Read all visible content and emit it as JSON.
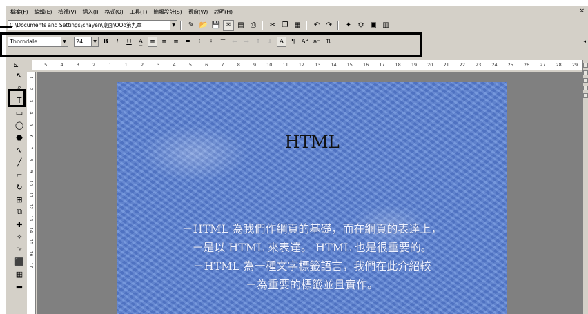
{
  "menubar": {
    "items": [
      "檔案(F)",
      "編輯(E)",
      "檢視(V)",
      "插入(I)",
      "格式(O)",
      "工具(T)",
      "簡報設計(S)",
      "視窗(W)",
      "說明(H)"
    ],
    "close": "×"
  },
  "toolbar": {
    "path": "C:\\Documents and Settings\\chayen\\桌面\\OOo第九章",
    "path_dropdown": "▼"
  },
  "format_toolbar": {
    "font_name": "Thorndale",
    "font_size": "24",
    "dropdown": "▼",
    "bold": "B",
    "italic": "I",
    "underline": "U"
  },
  "ruler": {
    "left_marks": [
      "5",
      "4",
      "3",
      "2",
      "1"
    ],
    "marks": [
      "1",
      "2",
      "3",
      "4",
      "5",
      "6",
      "7",
      "8",
      "9",
      "10",
      "11",
      "12",
      "13",
      "14",
      "15",
      "16",
      "17",
      "18",
      "19",
      "20",
      "21",
      "22",
      "23",
      "24",
      "25",
      "26",
      "27",
      "28",
      "29",
      "30",
      "31",
      "32",
      "33"
    ],
    "vertical_marks": [
      "1",
      "2",
      "3",
      "4",
      "5",
      "6",
      "7",
      "8",
      "9",
      "10",
      "11",
      "12",
      "13",
      "14",
      "15",
      "16",
      "17"
    ]
  },
  "slide": {
    "title": "HTML",
    "body_lines": [
      "－HTML 為我們作網頁的基礎，而在網頁的表達上，",
      "－是以 HTML 來表達。 HTML 也是很重要的。",
      "－HTML 為一種文字標籤語言，我們在此介紹較",
      "－為重要的標籤並且實作。"
    ]
  },
  "colors": {
    "window": "#d4d0c8",
    "slide_background": "#5b84d6",
    "workspace": "#808080",
    "highlight": "#000000"
  }
}
